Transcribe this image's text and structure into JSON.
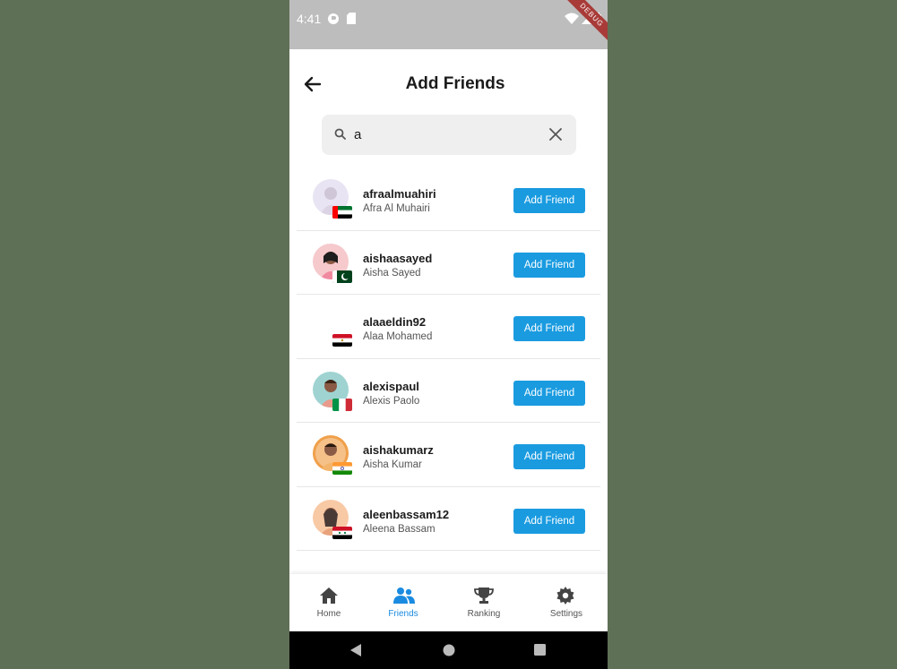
{
  "status_bar": {
    "time": "4:41",
    "debug_banner": "DEBUG"
  },
  "header": {
    "title": "Add Friends"
  },
  "search": {
    "value": "a"
  },
  "friend_list": [
    {
      "username": "afraalmuahiri",
      "name": "Afra Al Muhairi",
      "button": "Add Friend",
      "flag": "UAE",
      "avatar_color": "#e9e4f3"
    },
    {
      "username": "aishaasayed",
      "name": "Aisha Sayed",
      "button": "Add Friend",
      "flag": "Pakistan",
      "avatar_color": "#f6c9cc"
    },
    {
      "username": "alaaeldin92",
      "name": "Alaa Mohamed",
      "button": "Add Friend",
      "flag": "Egypt",
      "avatar_color": "#ffffff"
    },
    {
      "username": "alexispaul",
      "name": "Alexis Paolo",
      "button": "Add Friend",
      "flag": "Italy",
      "avatar_color": "#9fd3d2"
    },
    {
      "username": "aishakumarz",
      "name": "Aisha Kumar",
      "button": "Add Friend",
      "flag": "India",
      "avatar_color": "#f0a04b"
    },
    {
      "username": "aleenbassam12",
      "name": "Aleena Bassam",
      "button": "Add Friend",
      "flag": "Syria",
      "avatar_color": "#f8c9a5"
    }
  ],
  "bottom_nav": [
    {
      "label": "Home",
      "icon": "home-icon",
      "active": false
    },
    {
      "label": "Friends",
      "icon": "friends-icon",
      "active": true
    },
    {
      "label": "Ranking",
      "icon": "trophy-icon",
      "active": false
    },
    {
      "label": "Settings",
      "icon": "gear-icon",
      "active": false
    }
  ],
  "colors": {
    "accent": "#1a9be0",
    "background": "#5e7055",
    "status_bar": "#bdbdbd"
  }
}
